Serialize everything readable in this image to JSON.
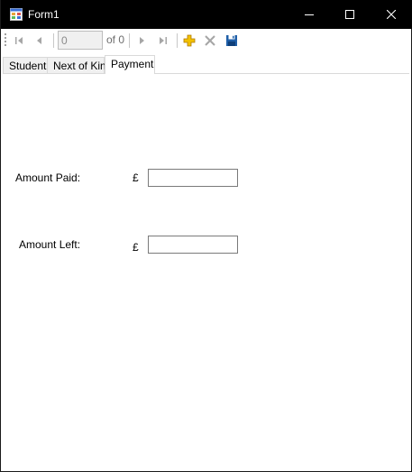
{
  "window": {
    "title": "Form1",
    "icon": "winforms-app-icon"
  },
  "title_buttons": {
    "minimize_icon": "minimize-icon",
    "maximize_icon": "maximize-icon",
    "close_icon": "close-icon"
  },
  "navigator": {
    "position": "0",
    "count_label": "of 0",
    "icons": [
      "move-first-icon",
      "move-previous-icon",
      "move-next-icon",
      "move-last-icon",
      "add-new-icon",
      "delete-icon",
      "save-icon"
    ],
    "colors": {
      "add": "#e0a000",
      "disabled": "#a6a6a6",
      "save": "#1f5fa8"
    }
  },
  "tabs": [
    {
      "label": "Student"
    },
    {
      "label": "Next of Kin"
    },
    {
      "label": "Payment",
      "active": true
    }
  ],
  "payment": {
    "amount_paid_label": "Amount Paid:",
    "amount_left_label": "Amount Left:",
    "currency_symbol": "£",
    "amount_paid_value": "",
    "amount_left_value": ""
  }
}
